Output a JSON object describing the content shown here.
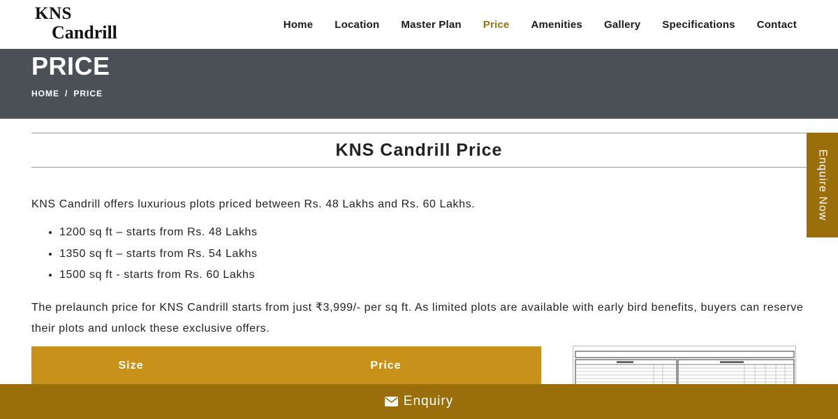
{
  "brand": {
    "line1": "KNS",
    "line2": "Candrill"
  },
  "nav": {
    "items": [
      {
        "label": "Home"
      },
      {
        "label": "Location"
      },
      {
        "label": "Master Plan"
      },
      {
        "label": "Price"
      },
      {
        "label": "Amenities"
      },
      {
        "label": "Gallery"
      },
      {
        "label": "Specifications"
      },
      {
        "label": "Contact"
      }
    ],
    "active": "Price"
  },
  "banner": {
    "title": "PRICE",
    "breadcrumb": {
      "home": "HOME",
      "separator": "/",
      "current": "PRICE"
    }
  },
  "section": {
    "title": "KNS Candrill Price"
  },
  "content": {
    "intro": "KNS Candrill offers luxurious plots priced between Rs. 48 Lakhs and Rs. 60 Lakhs.",
    "bullets": [
      "1200 sq ft – starts from Rs. 48 Lakhs",
      "1350 sq ft – starts from Rs. 54 Lakhs",
      "1500 sq ft - starts from Rs. 60 Lakhs"
    ],
    "prelaunch": "The prelaunch price for KNS Candrill starts from just ₹3,999/- per sq ft. As limited plots are available with early bird benefits, buyers can reserve their plots and unlock these exclusive offers."
  },
  "table": {
    "headers": {
      "size": "Size",
      "price": "Price"
    }
  },
  "side_tab": {
    "label": "Enquire Now"
  },
  "enquiry_bar": {
    "label": "Enquiry",
    "icon": "envelope-icon"
  },
  "colors": {
    "accent_gold": "#c8921a",
    "dark_gold": "#9a6e0a",
    "active_nav": "#9a7214",
    "banner_bg": "#4b5057"
  }
}
